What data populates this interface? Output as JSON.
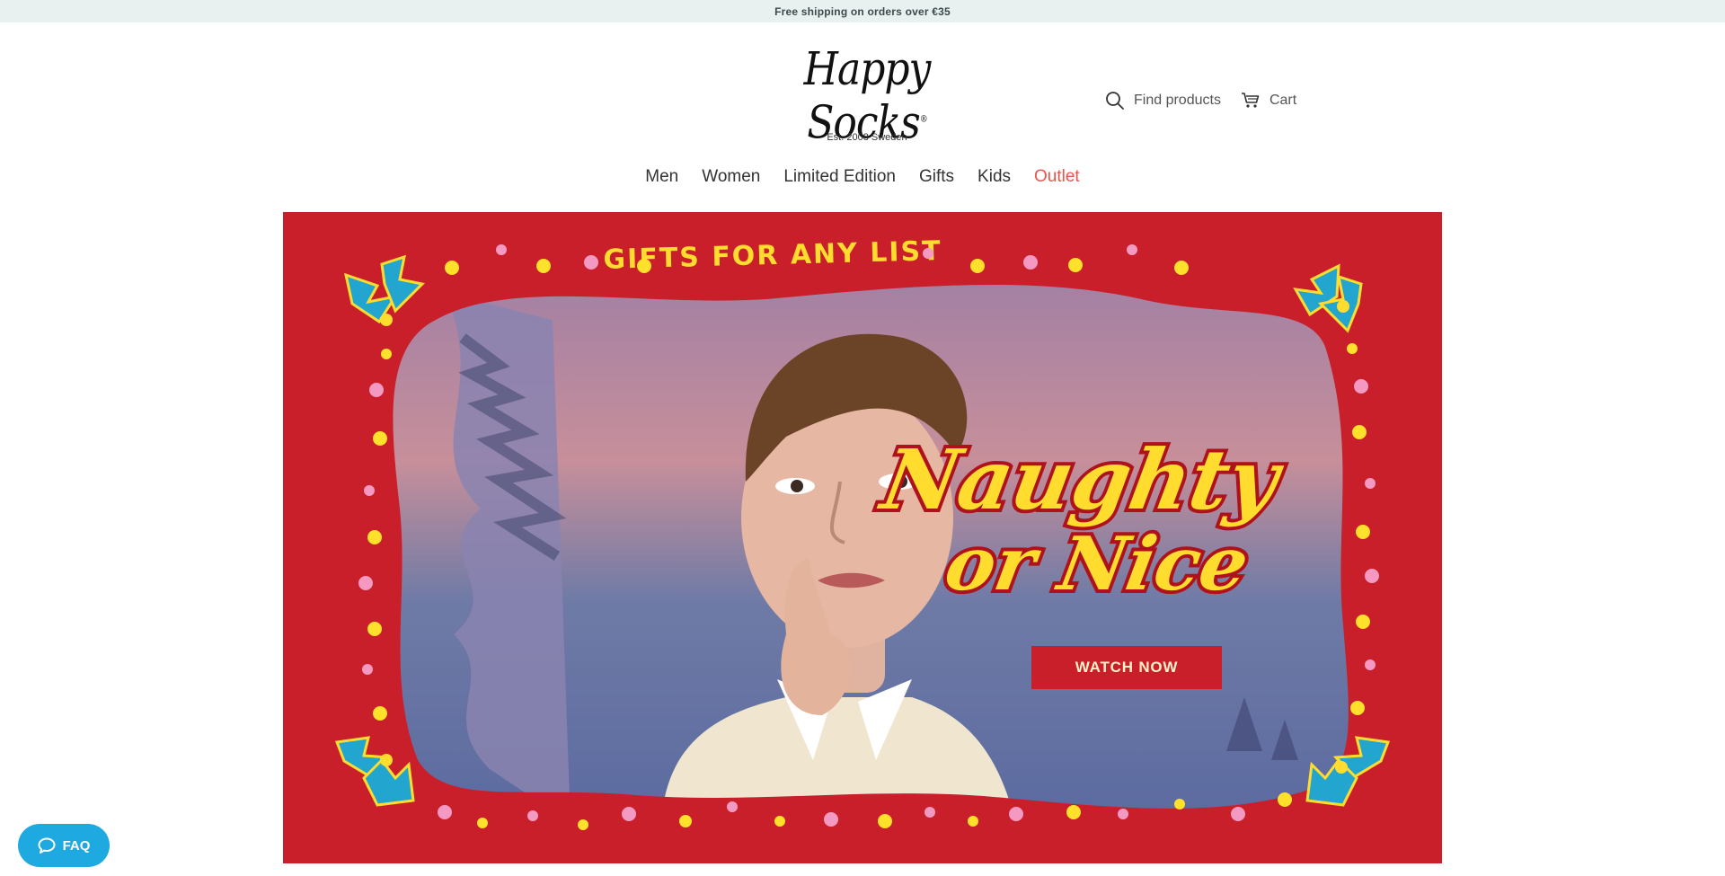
{
  "announcement": {
    "text": "Free shipping on orders over €35"
  },
  "brand": {
    "logo": "Happy Socks",
    "tagline": "Est. 2008 Sweden"
  },
  "header": {
    "search": {
      "label": "Find products",
      "icon": "search-icon"
    },
    "cart": {
      "label": "Cart",
      "icon": "cart-icon"
    }
  },
  "nav": {
    "items": [
      {
        "label": "Men"
      },
      {
        "label": "Women"
      },
      {
        "label": "Limited Edition"
      },
      {
        "label": "Gifts"
      },
      {
        "label": "Kids"
      },
      {
        "label": "Outlet",
        "accent": "#e8554e"
      }
    ]
  },
  "hero": {
    "banner_text": "GIFTS FOR ANY LIST",
    "headline_line1": "Naughty",
    "headline_line2": "or Nice",
    "cta": "WATCH NOW",
    "colors": {
      "background": "#c91f2b",
      "headline": "#ffdc2e",
      "dots_yellow": "#ffe02a",
      "dots_pink": "#f49ac2"
    }
  },
  "faq": {
    "label": "FAQ",
    "icon": "chat-bubble-icon"
  }
}
